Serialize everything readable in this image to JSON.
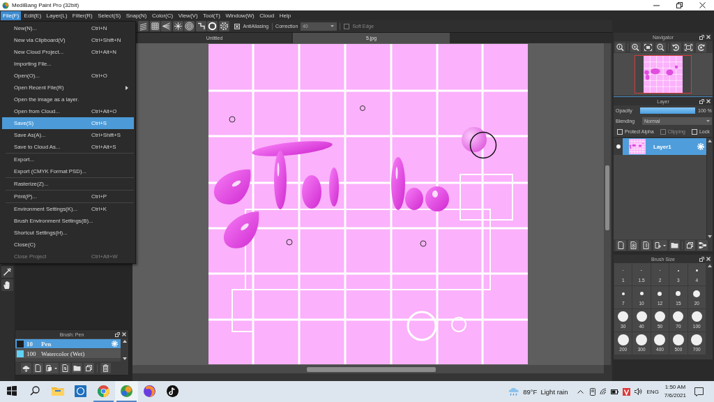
{
  "window": {
    "title": "MediBang Paint Pro (32bit)"
  },
  "menu_bar": [
    {
      "label": "File(F)",
      "selected": true
    },
    {
      "label": "Edit(E)",
      "selected": false
    },
    {
      "label": "Layer(L)",
      "selected": false
    },
    {
      "label": "Filter(R)",
      "selected": false
    },
    {
      "label": "Select(S)",
      "selected": false
    },
    {
      "label": "Snap(N)",
      "selected": false
    },
    {
      "label": "Color(C)",
      "selected": false
    },
    {
      "label": "View(V)",
      "selected": false
    },
    {
      "label": "Tool(T)",
      "selected": false
    },
    {
      "label": "Window(W)",
      "selected": false
    },
    {
      "label": "Cloud",
      "selected": false
    },
    {
      "label": "Help",
      "selected": false
    }
  ],
  "file_menu": {
    "items": [
      {
        "kind": "item",
        "label": "New(N)...",
        "shortcut": "Ctrl+N",
        "submenu": false,
        "selected": false,
        "disabled": false
      },
      {
        "kind": "item",
        "label": "New via Clipboard(V)",
        "shortcut": "Ctrl+Shift+N",
        "submenu": false,
        "selected": false,
        "disabled": false
      },
      {
        "kind": "item",
        "label": "New Cloud Project...",
        "shortcut": "Ctrl+Alt+N",
        "submenu": false,
        "selected": false,
        "disabled": false
      },
      {
        "kind": "item",
        "label": "Importing File...",
        "submenu": false,
        "selected": false,
        "disabled": false
      },
      {
        "kind": "item",
        "label": "Open(O)...",
        "shortcut": "Ctrl+O",
        "submenu": false,
        "selected": false,
        "disabled": false
      },
      {
        "kind": "item",
        "label": "Open Recent File(R)",
        "submenu": true,
        "selected": false,
        "disabled": false
      },
      {
        "kind": "item",
        "label": "Open the image as a layer.",
        "submenu": false,
        "selected": false,
        "disabled": false
      },
      {
        "kind": "item",
        "label": "Open from Cloud...",
        "shortcut": "Ctrl+Alt+O",
        "submenu": false,
        "selected": false,
        "disabled": false
      },
      {
        "kind": "item",
        "label": "Save(S)",
        "shortcut": "Ctrl+S",
        "submenu": false,
        "selected": true,
        "disabled": false
      },
      {
        "kind": "item",
        "label": "Save As(A)...",
        "shortcut": "Ctrl+Shift+S",
        "submenu": false,
        "selected": false,
        "disabled": false
      },
      {
        "kind": "item",
        "label": "Save to Cloud As...",
        "shortcut": "Ctrl+Alt+S",
        "submenu": false,
        "selected": false,
        "disabled": false
      },
      {
        "kind": "separator"
      },
      {
        "kind": "item",
        "label": "Export...",
        "submenu": false,
        "selected": false,
        "disabled": false
      },
      {
        "kind": "item",
        "label": "Export (CMYK Format PSD)...",
        "submenu": false,
        "selected": false,
        "disabled": false
      },
      {
        "kind": "separator"
      },
      {
        "kind": "item",
        "label": "Rasterize(Z)...",
        "submenu": false,
        "selected": false,
        "disabled": false
      },
      {
        "kind": "separator"
      },
      {
        "kind": "item",
        "label": "Print(P)...",
        "shortcut": "Ctrl+P",
        "submenu": false,
        "selected": false,
        "disabled": false
      },
      {
        "kind": "separator"
      },
      {
        "kind": "item",
        "label": "Environment Settings(K)...",
        "shortcut": "Ctrl+K",
        "submenu": false,
        "selected": false,
        "disabled": false
      },
      {
        "kind": "item",
        "label": "Brush Environment Settings(B)...",
        "submenu": false,
        "selected": false,
        "disabled": false
      },
      {
        "kind": "item",
        "label": "Shortcut Settings(H)...",
        "submenu": false,
        "selected": false,
        "disabled": false
      },
      {
        "kind": "item",
        "label": "Close(C)",
        "submenu": false,
        "selected": false,
        "disabled": false
      },
      {
        "kind": "item",
        "label": "Close Project",
        "shortcut": "Ctrl+Alt+W",
        "submenu": false,
        "selected": false,
        "disabled": true
      }
    ]
  },
  "toolbar": {
    "antialiasing": {
      "label": "AntiAliasing",
      "checked": true,
      "disabled": false
    },
    "correction": {
      "label": "Correction",
      "value": "40"
    },
    "soft_edge": {
      "label": "Soft Edge",
      "checked": false,
      "disabled": true
    }
  },
  "document_tabs": [
    {
      "label": "Untitled",
      "selected": false
    },
    {
      "label": "5.jpg",
      "selected": true
    }
  ],
  "navigator": {
    "title": "Navigator"
  },
  "layer_panel": {
    "title": "Layer",
    "opacity": {
      "label": "Opacity",
      "level": 1,
      "reading": "100 %"
    },
    "blending": {
      "label": "Blending",
      "value": "Normal"
    },
    "options": [
      {
        "label": "Protect Alpha",
        "checked": false,
        "disabled": false
      },
      {
        "label": "Clipping",
        "checked": false,
        "disabled": true
      },
      {
        "label": "Lock",
        "checked": false,
        "disabled": false
      }
    ],
    "layers": [
      {
        "name": "Layer1",
        "visible": true,
        "selected": true
      }
    ]
  },
  "brush_size_panel": {
    "title": "Brush Size",
    "sizes": [
      "1",
      "1.5",
      "2",
      "3",
      "4",
      "7",
      "10",
      "12",
      "15",
      "20",
      "30",
      "40",
      "50",
      "70",
      "100",
      "200",
      "300",
      "400",
      "500",
      "700"
    ]
  },
  "brush_panel": {
    "title": "Brush: Pen",
    "brushes": [
      {
        "size": "10",
        "name": "Pen",
        "color": "#1e1e1e",
        "selected": true
      },
      {
        "size": "100",
        "name": "Watercolor (Wet)",
        "color": "#5fd2f6",
        "selected": false
      }
    ]
  },
  "taskbar": {
    "apps": [
      {
        "kind": "start",
        "running": false,
        "active": false
      },
      {
        "kind": "search",
        "running": false,
        "active": false
      },
      {
        "kind": "files",
        "running": false,
        "active": false
      },
      {
        "kind": "tile",
        "running": false,
        "active": false
      },
      {
        "kind": "browser",
        "running": true,
        "active": false
      },
      {
        "kind": "paint",
        "running": true,
        "active": true
      },
      {
        "kind": "orb",
        "running": false,
        "active": false
      },
      {
        "kind": "note",
        "running": false,
        "active": false
      }
    ],
    "weather": {
      "temperature": "89°F",
      "condition": "Light rain"
    },
    "language": "ENG",
    "time": "1:50 AM",
    "date": "7/6/2021"
  }
}
